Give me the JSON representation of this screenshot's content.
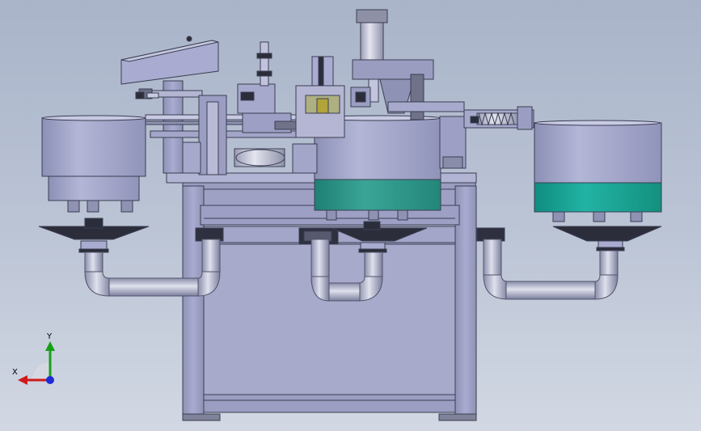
{
  "viewport": {
    "background_top": "#a9b4c9",
    "background_bottom": "#d2d8e3"
  },
  "model": {
    "frame_color": "#9ea2c4",
    "frame_edge": "#3b3e52",
    "feeder_bowl_color": "#a6a9cc",
    "teal_band_color": "#2e9a8c",
    "left_teal_band_color": "#1aa597",
    "pipe_color": "#c3c6dc"
  },
  "triad": {
    "x_label": "X",
    "y_label": "Y",
    "x_axis_color": "#d11919",
    "y_axis_color": "#16a016",
    "z_axis_color": "#1c2bd6"
  }
}
